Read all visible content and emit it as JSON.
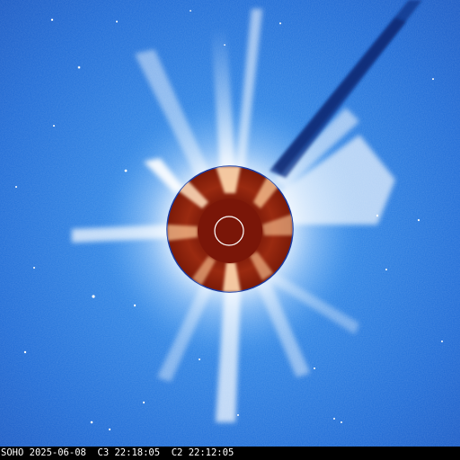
{
  "observatory": "SOHO",
  "date": "2025-06-08",
  "c3_label": "C3",
  "c3_time": "22:18:05",
  "c2_label": "C2",
  "c2_time": "22:12:05",
  "colors": {
    "c3_background": "#1f70d6",
    "streamer": "#ffffff",
    "c2_disk": "#8a1a0a",
    "c2_bright": "#ffcc99",
    "occulter_inner": "#7a1608",
    "sun_outline": "#ffffff",
    "caption_bg": "#000000",
    "caption_text": "#ffffff"
  }
}
